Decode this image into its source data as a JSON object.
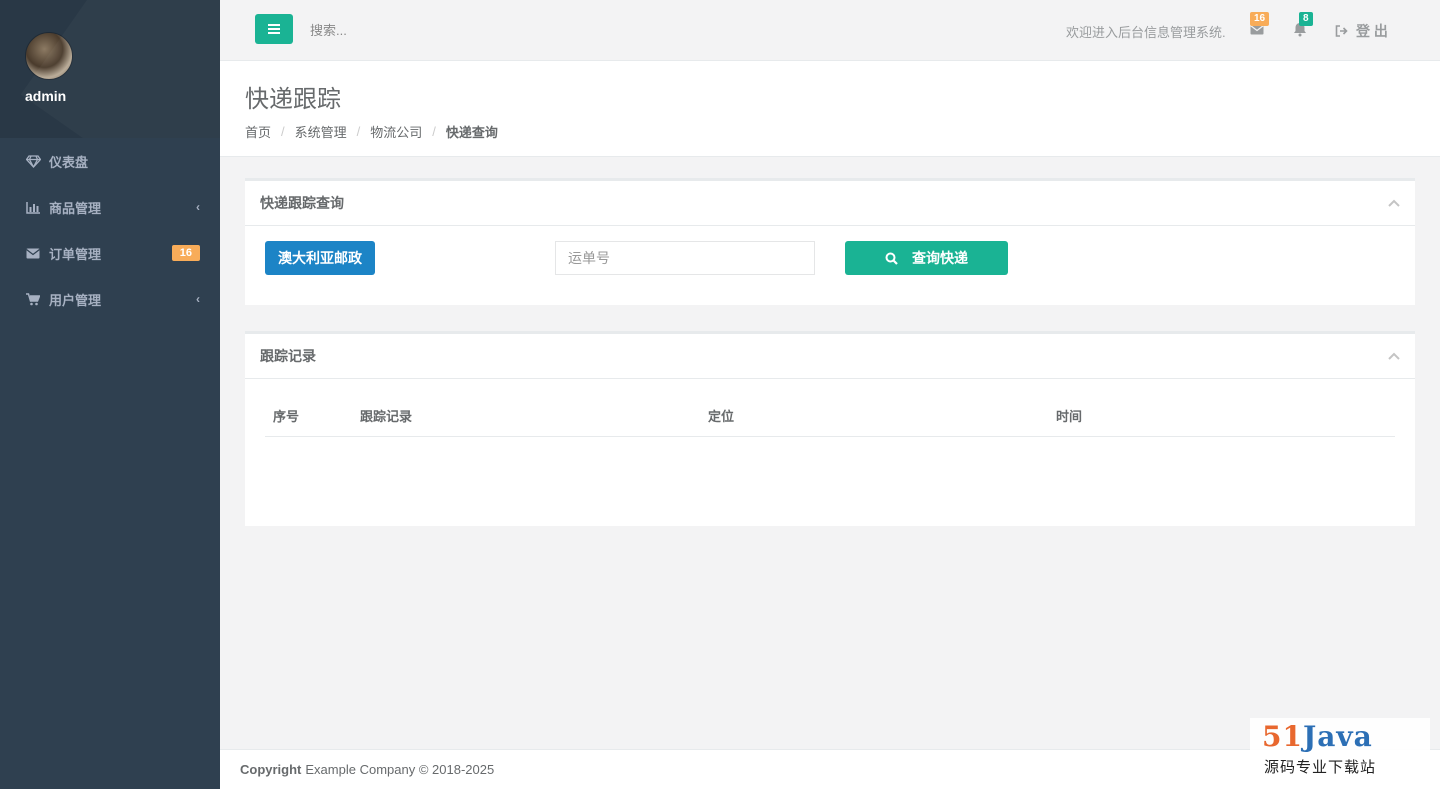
{
  "sidebar": {
    "user_name": "admin",
    "items": [
      {
        "label": "仪表盘",
        "icon": "diamond-icon"
      },
      {
        "label": "商品管理",
        "icon": "bar-chart-icon"
      },
      {
        "label": "订单管理",
        "icon": "envelope-icon",
        "badge": "16"
      },
      {
        "label": "用户管理",
        "icon": "cart-icon"
      }
    ]
  },
  "topbar": {
    "search_placeholder": "搜索...",
    "welcome": "欢迎进入后台信息管理系统.",
    "mail_count": "16",
    "notification_count": "8",
    "logout": "登 出"
  },
  "page": {
    "title": "快递跟踪",
    "breadcrumb": [
      "首页",
      "系统管理",
      "物流公司"
    ],
    "breadcrumb_active": "快递查询"
  },
  "query_panel": {
    "title": "快递跟踪查询",
    "company_button": "澳大利亚邮政",
    "tracking_placeholder": "运单号",
    "query_button": "查询快递"
  },
  "records_panel": {
    "title": "跟踪记录",
    "columns": [
      "序号",
      "跟踪记录",
      "定位",
      "时间"
    ]
  },
  "footer": {
    "copyright_label": "Copyright",
    "company": "Example Company © 2018-2025"
  },
  "watermark": {
    "logo_num": "51",
    "logo_word": "Java",
    "subtitle": "源码专业下载站"
  },
  "colors": {
    "sidebar_bg": "#2f4050",
    "primary": "#1ab394",
    "info": "#1c84c6",
    "warning": "#f8ac59"
  }
}
